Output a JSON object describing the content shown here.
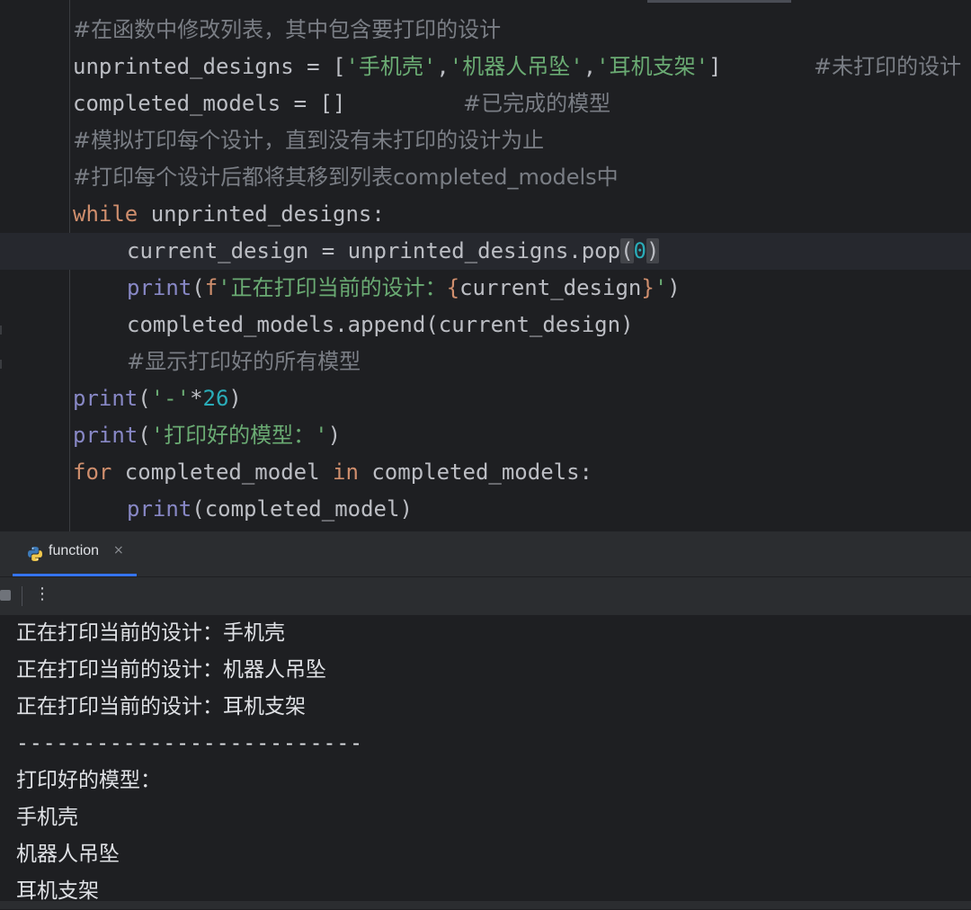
{
  "editor": {
    "lines": [
      {
        "comment": "#在函数中修改列表，其中包含要打印的设计"
      },
      {
        "var": "unprinted_designs",
        "op": " = [",
        "s1": "'手机壳'",
        "c1": ",",
        "s2": "'机器人吊坠'",
        "c2": ",",
        "s3": "'耳机支架'",
        "close": "]",
        "trailing_comment": "#未打印的设计"
      },
      {
        "var": "completed_models",
        "op": " = []",
        "trailing_comment": "#已完成的模型"
      },
      {
        "comment": "#模拟打印每个设计，直到没有未打印的设计为止"
      },
      {
        "comment": "#打印每个设计后都将其移到列表completed_models中"
      },
      {
        "kw": "while",
        "rest": " unprinted_designs:"
      },
      {
        "a": "current_design = unprinted_designs.pop",
        "lp": "(",
        "num": "0",
        "rp": ")"
      },
      {
        "fn": "print",
        "lp": "(",
        "f": "f",
        "s_open": "'正在打印当前的设计：",
        "lb": "{",
        "expr": "current_design",
        "rb": "}",
        "s_close": "'",
        "rp": ")"
      },
      {
        "text": "completed_models.append(current_design)"
      },
      {
        "comment": "#显示打印好的所有模型"
      },
      {
        "fn": "print",
        "lp": "(",
        "s": "'-'",
        "op": "*",
        "num": "26",
        "rp": ")"
      },
      {
        "fn": "print",
        "lp": "(",
        "s": "'打印好的模型：'",
        "rp": ")"
      },
      {
        "kw1": "for",
        "mid1": " completed_model ",
        "kw2": "in",
        "mid2": " completed_models:"
      },
      {
        "fn": "print",
        "rest": "(completed_model)"
      }
    ]
  },
  "run_panel": {
    "tab_label": "function",
    "tab_close": "×",
    "more_icon": "⋮",
    "output": [
      "正在打印当前的设计：手机壳",
      "正在打印当前的设计：机器人吊坠",
      "正在打印当前的设计：耳机支架",
      "--------------------------",
      "打印好的模型：",
      "手机壳",
      "机器人吊坠",
      "耳机支架"
    ]
  },
  "colors": {
    "background": "#1e1f22",
    "comment": "#7a7e85",
    "string": "#6aab73",
    "keyword": "#cf8e6d",
    "builtin": "#8888c6",
    "number": "#2aacb8",
    "accent": "#3574f0"
  },
  "icons": {
    "tab_icon": "python-icon",
    "stop": "stop-icon",
    "more": "more-vertical-icon"
  }
}
